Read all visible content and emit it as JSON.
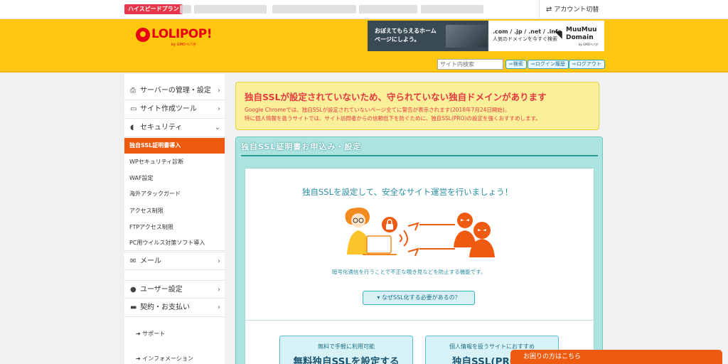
{
  "topbar": {
    "plan_badge": "ハイスピードプラン",
    "account_switch": "アカウント切替"
  },
  "header": {
    "logo_text": "LOLIPOP!",
    "logo_sub": "by GMOペパボ",
    "banner": {
      "left_text": "おぼえてもらえるホームページにしよう。",
      "domains": ".com / .jp / .net / .info",
      "domains_sub": "人気のドメインを今すぐ検索",
      "brand": "MuuMuu Domain",
      "brand_sub": "by GMOペパボ"
    },
    "search_placeholder": "サイト内検索",
    "buttons": [
      "検索",
      "ログイン履歴",
      "ログアウト"
    ]
  },
  "sidebar": {
    "items": [
      {
        "label": "サーバーの管理・設定",
        "icon": "server-icon"
      },
      {
        "label": "サイト作成ツール",
        "icon": "laptop-icon"
      },
      {
        "label": "セキュリティ",
        "icon": "shield-icon"
      }
    ],
    "security_sub": [
      {
        "label": "独自SSL証明書導入",
        "active": true
      },
      {
        "label": "WPセキュリティ診断",
        "active": false
      },
      {
        "label": "WAF設定",
        "active": false
      },
      {
        "label": "海外アタックガード",
        "active": false
      },
      {
        "label": "アクセス制限",
        "active": false
      },
      {
        "label": "FTPアクセス制限",
        "active": false
      },
      {
        "label": "PC用ウイルス対策ソフト導入",
        "active": false
      }
    ],
    "items_after": [
      {
        "label": "メール",
        "icon": "mail-icon"
      },
      {
        "label": "ユーザー設定",
        "icon": "user-icon"
      },
      {
        "label": "契約・お支払い",
        "icon": "card-icon"
      }
    ],
    "links": [
      "サポート",
      "インフォメーション"
    ]
  },
  "alert": {
    "title": "独自SSLが設定されていないため、守られていない独自ドメインがあります",
    "line1": "Google Chromeでは、独自SSLが設定されていないページ全てに警告が表示されます(2018年7月24日開始)。",
    "line2": "特に個人情報を扱うサイトでは、サイト訪問者からの信頼低下を防ぐために、独自SSL(PRO)の設定を強くおすすめします。"
  },
  "panel": {
    "title": "独自SSL証明書お申込み・設定",
    "heading": "独自SSLを設定して、安全なサイト運営を行いましょう！",
    "description": "暗号化通信を行うことで不正な覗き見などを防止する機能です。",
    "why_button": "▾ なぜSSL化する必要があるの？",
    "cards": [
      {
        "small": "無料で手軽に利用可能",
        "big": "無料独自SSLを設定する"
      },
      {
        "small": "個人情報を扱うサイトにおすすめ",
        "big": "独自SSL(PRO)を"
      }
    ]
  },
  "help_tab": "お困りの方はこちら",
  "colors": {
    "brand_yellow": "#fdc70f",
    "accent_orange": "#ee5a0f",
    "alert_red": "#e6393f",
    "teal": "#2a9c96"
  }
}
